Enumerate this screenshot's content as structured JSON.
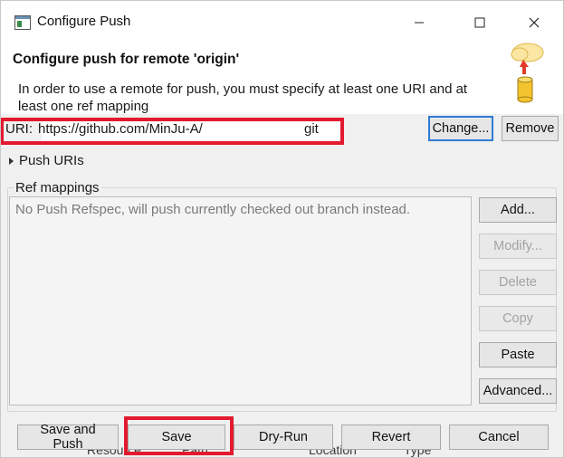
{
  "window": {
    "title": "Configure Push",
    "icon": "eclipse-dialog-icon",
    "controls": [
      "minimize-icon",
      "maximize-icon",
      "close-icon"
    ]
  },
  "header": {
    "heading": "Configure push for remote 'origin'",
    "description": "In order to use a remote for push, you must specify at least one URI and at least one ref mapping",
    "image": "cloud-upload-database-icon"
  },
  "uri": {
    "label": "URI:",
    "value": "https://github.com/MinJu-A/",
    "tail": "git",
    "change_label": "Change...",
    "remove_label": "Remove"
  },
  "push_uris": {
    "label": "Push URIs",
    "icon": "expand-arrow-icon"
  },
  "ref_mappings": {
    "group_label": "Ref mappings",
    "empty_text": "No Push Refspec, will push currently checked out branch instead.",
    "buttons": {
      "add": "Add...",
      "modify": "Modify...",
      "delete": "Delete",
      "copy": "Copy",
      "paste": "Paste",
      "advanced": "Advanced..."
    }
  },
  "footer": {
    "save_and_push": "Save and Push",
    "save": "Save",
    "dry_run": "Dry-Run",
    "revert": "Revert",
    "cancel": "Cancel"
  },
  "background_columns": [
    "Resource",
    "Path",
    "Location",
    "Type"
  ],
  "colors": {
    "highlight": "#e3192f",
    "focus": "#2f7bd3",
    "dialog_bg": "#f0f0f0"
  }
}
